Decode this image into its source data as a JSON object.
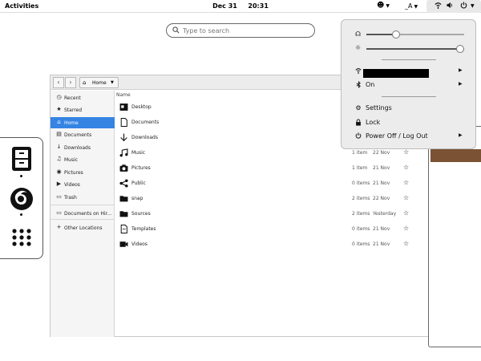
{
  "topbar": {
    "activities": "Activities",
    "date": "Dec 31",
    "time": "20:31",
    "a11y_icon": "accessibility-icon",
    "keyboard_label": "_A",
    "system_icons": [
      "network-icon",
      "volume-icon",
      "power-icon"
    ]
  },
  "search": {
    "placeholder": "Type to search"
  },
  "dash": {
    "apps": [
      "files-app-icon",
      "firefox-app-icon",
      "show-apps-icon"
    ]
  },
  "files": {
    "path_label": "Home",
    "column_name": "Name",
    "sidebar": [
      {
        "label": "Recent",
        "icon": "clock-icon"
      },
      {
        "label": "Starred",
        "icon": "star-icon"
      },
      {
        "label": "Home",
        "icon": "home-icon",
        "active": true
      },
      {
        "label": "Documents",
        "icon": "document-icon"
      },
      {
        "label": "Downloads",
        "icon": "download-icon"
      },
      {
        "label": "Music",
        "icon": "music-icon"
      },
      {
        "label": "Pictures",
        "icon": "camera-icon"
      },
      {
        "label": "Videos",
        "icon": "video-icon"
      },
      {
        "label": "Trash",
        "icon": "trash-icon"
      },
      {
        "label": "Documents on Hir...",
        "icon": "drive-icon"
      },
      {
        "label": "Other Locations",
        "icon": "plus-icon"
      }
    ],
    "rows": [
      {
        "name": "Desktop",
        "size": "",
        "modified": ""
      },
      {
        "name": "Documents",
        "size": "",
        "modified": ""
      },
      {
        "name": "Downloads",
        "size": "",
        "modified": ""
      },
      {
        "name": "Music",
        "size": "1 item",
        "modified": "22 Nov"
      },
      {
        "name": "Pictures",
        "size": "1 item",
        "modified": "21 Nov"
      },
      {
        "name": "Public",
        "size": "0 items",
        "modified": "21 Nov"
      },
      {
        "name": "snap",
        "size": "2 items",
        "modified": "22 Nov"
      },
      {
        "name": "Sources",
        "size": "2 items",
        "modified": "Yesterday"
      },
      {
        "name": "Templates",
        "size": "0 items",
        "modified": "21 Nov"
      },
      {
        "name": "Videos",
        "size": "0 items",
        "modified": "21 Nov"
      }
    ]
  },
  "system_menu": {
    "volume_level": 0.3,
    "brightness_level": 1.0,
    "wifi_label": "",
    "bluetooth_label": "On",
    "settings_label": "Settings",
    "lock_label": "Lock",
    "power_label": "Power Off / Log Out"
  },
  "colors": {
    "accent": "#3584e4",
    "popup_bg": "#ececec"
  }
}
